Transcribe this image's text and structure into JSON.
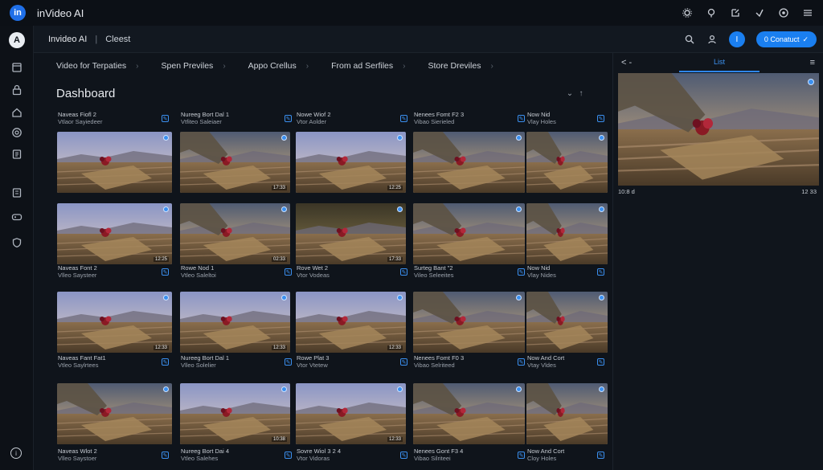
{
  "window": {
    "logo": "in",
    "title": "inVideo AI"
  },
  "header": {
    "title": "Invideo AI",
    "separator": "|",
    "client": "Cleest",
    "user_initial": "I",
    "action_button": "0 Conatuct"
  },
  "sidebar": {
    "avatar": "A"
  },
  "nav": {
    "items": [
      "Video for Terpaties",
      "Spen Previles",
      "Appo Crellus",
      "From ad Serfiles",
      "Store Dreviles"
    ]
  },
  "dashboard": {
    "title": "Dashboard"
  },
  "cards": [
    {
      "t": "Naveas Fiofl 2",
      "s": "Vtlaor Sayiedeer",
      "time": "",
      "v": 0
    },
    {
      "t": "Nureeg Bort Dal 1",
      "s": "Vtfiteo Saleiaer",
      "time": "17:33",
      "v": 1
    },
    {
      "t": "Nowe Wiof 2",
      "s": "Vtor Aolder",
      "time": "12:25",
      "v": 0
    },
    {
      "t": "Nenees Fomt F2 3",
      "s": "Vibao Sierieled",
      "time": "",
      "v": 1
    },
    {
      "t": "Now Nid",
      "s": "Vlay Holes",
      "time": "",
      "v": 1
    },
    {
      "t": "Naveas Font 2",
      "s": "Vlleo Saysteer",
      "time": "12:25",
      "v": 0
    },
    {
      "t": "Rowe Nod 1",
      "s": "Vtleo Saleltoi",
      "time": "02:33",
      "v": 1
    },
    {
      "t": "Rove Wet 2",
      "s": "Vtor Vodeas",
      "time": "17:33",
      "v": 2
    },
    {
      "t": "Surteg Bant \"2",
      "s": "Vileo Seleeites",
      "time": "",
      "v": 1
    },
    {
      "t": "Now Nid",
      "s": "Vlay Nides",
      "time": "",
      "v": 1
    },
    {
      "t": "Naveas Fant Fat1",
      "s": "Vtleo Saylrtees",
      "time": "12:33",
      "v": 0
    },
    {
      "t": "Nureeg Bort Dal 1",
      "s": "Vlleo Solelier",
      "time": "12:33",
      "v": 0
    },
    {
      "t": "Rowe Plat 3",
      "s": "Vtor Vtetew",
      "time": "12:33",
      "v": 0
    },
    {
      "t": "Nenees Fomt F0 3",
      "s": "Vibao Selriteed",
      "time": "",
      "v": 1
    },
    {
      "t": "Now And Cort",
      "s": "Vtay Vldes",
      "time": "",
      "v": 1
    },
    {
      "t": "Naveas Wlot 2",
      "s": "Vlleo Saystoer",
      "time": "",
      "v": 1
    },
    {
      "t": "Nureeg Bort Dai 4",
      "s": "Vtleo Salehes",
      "time": "10:38",
      "v": 0
    },
    {
      "t": "Sovre Wiol 3 2 4",
      "s": "Vtor Vidoras",
      "time": "12:33",
      "v": 0
    },
    {
      "t": "Nenees Gont F3 4",
      "s": "Vibao Silriteei",
      "time": "",
      "v": 1
    },
    {
      "t": "Now And Cort",
      "s": "Cloy Holes",
      "time": "",
      "v": 1
    }
  ],
  "right_panel": {
    "back": "< -",
    "tab": "List",
    "menu": "≡",
    "meta_left": "10:8 d",
    "meta_right": "12 33"
  }
}
